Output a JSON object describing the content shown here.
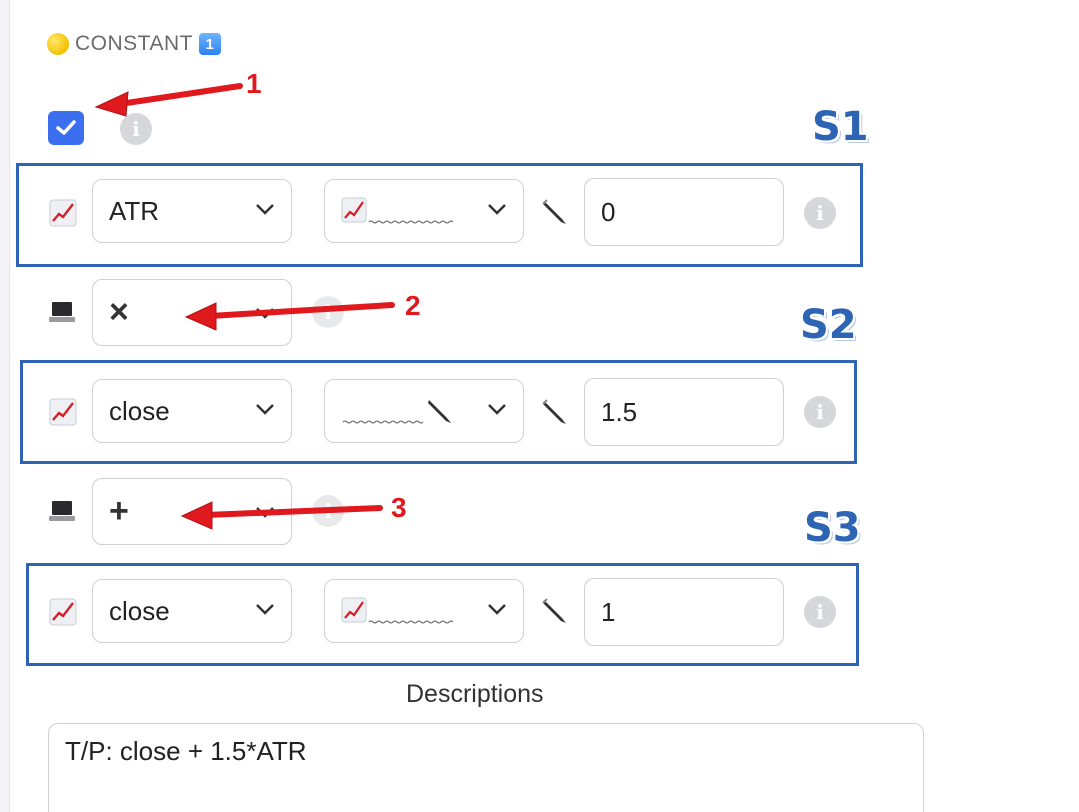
{
  "header": {
    "title": "CONSTANT",
    "badge": "1"
  },
  "enabled_checkbox": {
    "checked": true
  },
  "annotations": {
    "arrow_labels": [
      "1",
      "2",
      "3"
    ],
    "section_labels": [
      "S1",
      "S2",
      "S3"
    ]
  },
  "rows": [
    {
      "type": "series",
      "source": "ATR",
      "style": "chart-line-icon",
      "value": "0"
    },
    {
      "type": "operator",
      "operator": "×"
    },
    {
      "type": "series",
      "source": "close",
      "style": "pen-icon",
      "value": "1.5"
    },
    {
      "type": "operator",
      "operator": "+"
    },
    {
      "type": "series",
      "source": "close",
      "style": "chart-line-icon",
      "value": "1"
    }
  ],
  "description": {
    "label": "Descriptions",
    "text": "T/P: close + 1.5*ATR"
  },
  "colors": {
    "accent": "#3b6ff0",
    "frame": "#2d64b3",
    "annotation": "#e0191f"
  }
}
